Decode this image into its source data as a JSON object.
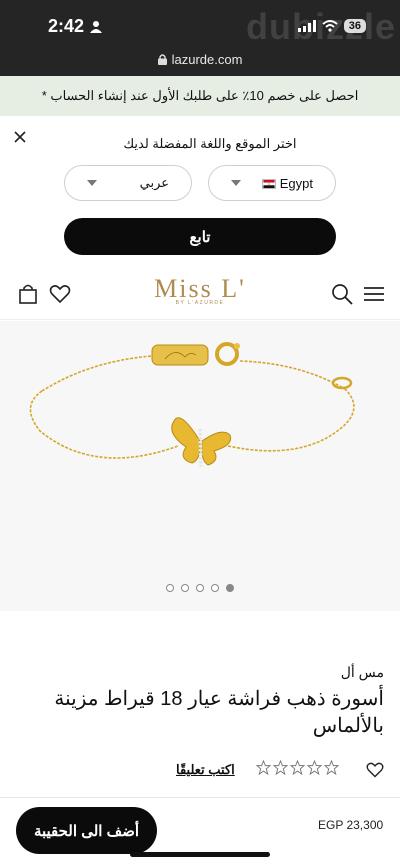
{
  "status_bar": {
    "time": "2:42",
    "battery": "36",
    "watermark": "dubizzle"
  },
  "browser": {
    "url": "lazurde.com"
  },
  "promo": {
    "text": "احصل على خصم 10٪ على طلبك الأول عند إنشاء الحساب *"
  },
  "region_selector": {
    "title": "اختر الموقع واللغة المفضلة لديك",
    "country": "Egypt",
    "language": "عربي",
    "continue_label": "تابع"
  },
  "header": {
    "logo": "Miss L'",
    "logo_sub": "BY L'AZURDE"
  },
  "gallery": {
    "slide_count": 5,
    "active_slide": 5
  },
  "product": {
    "brand": "مس أل",
    "title": "أسورة ذهب فراشة عيار 18 قيراط مزينة بالألماس",
    "rating_stars": 0,
    "review_link": "اكتب تعليقًا"
  },
  "purchase": {
    "price": "EGP 23,300",
    "add_to_bag_label": "أضف الى الحقيبة"
  },
  "colors": {
    "brand_gold": "#b08b4f",
    "promo_bg": "#e6eee4",
    "button_black": "#0b0b0b"
  }
}
